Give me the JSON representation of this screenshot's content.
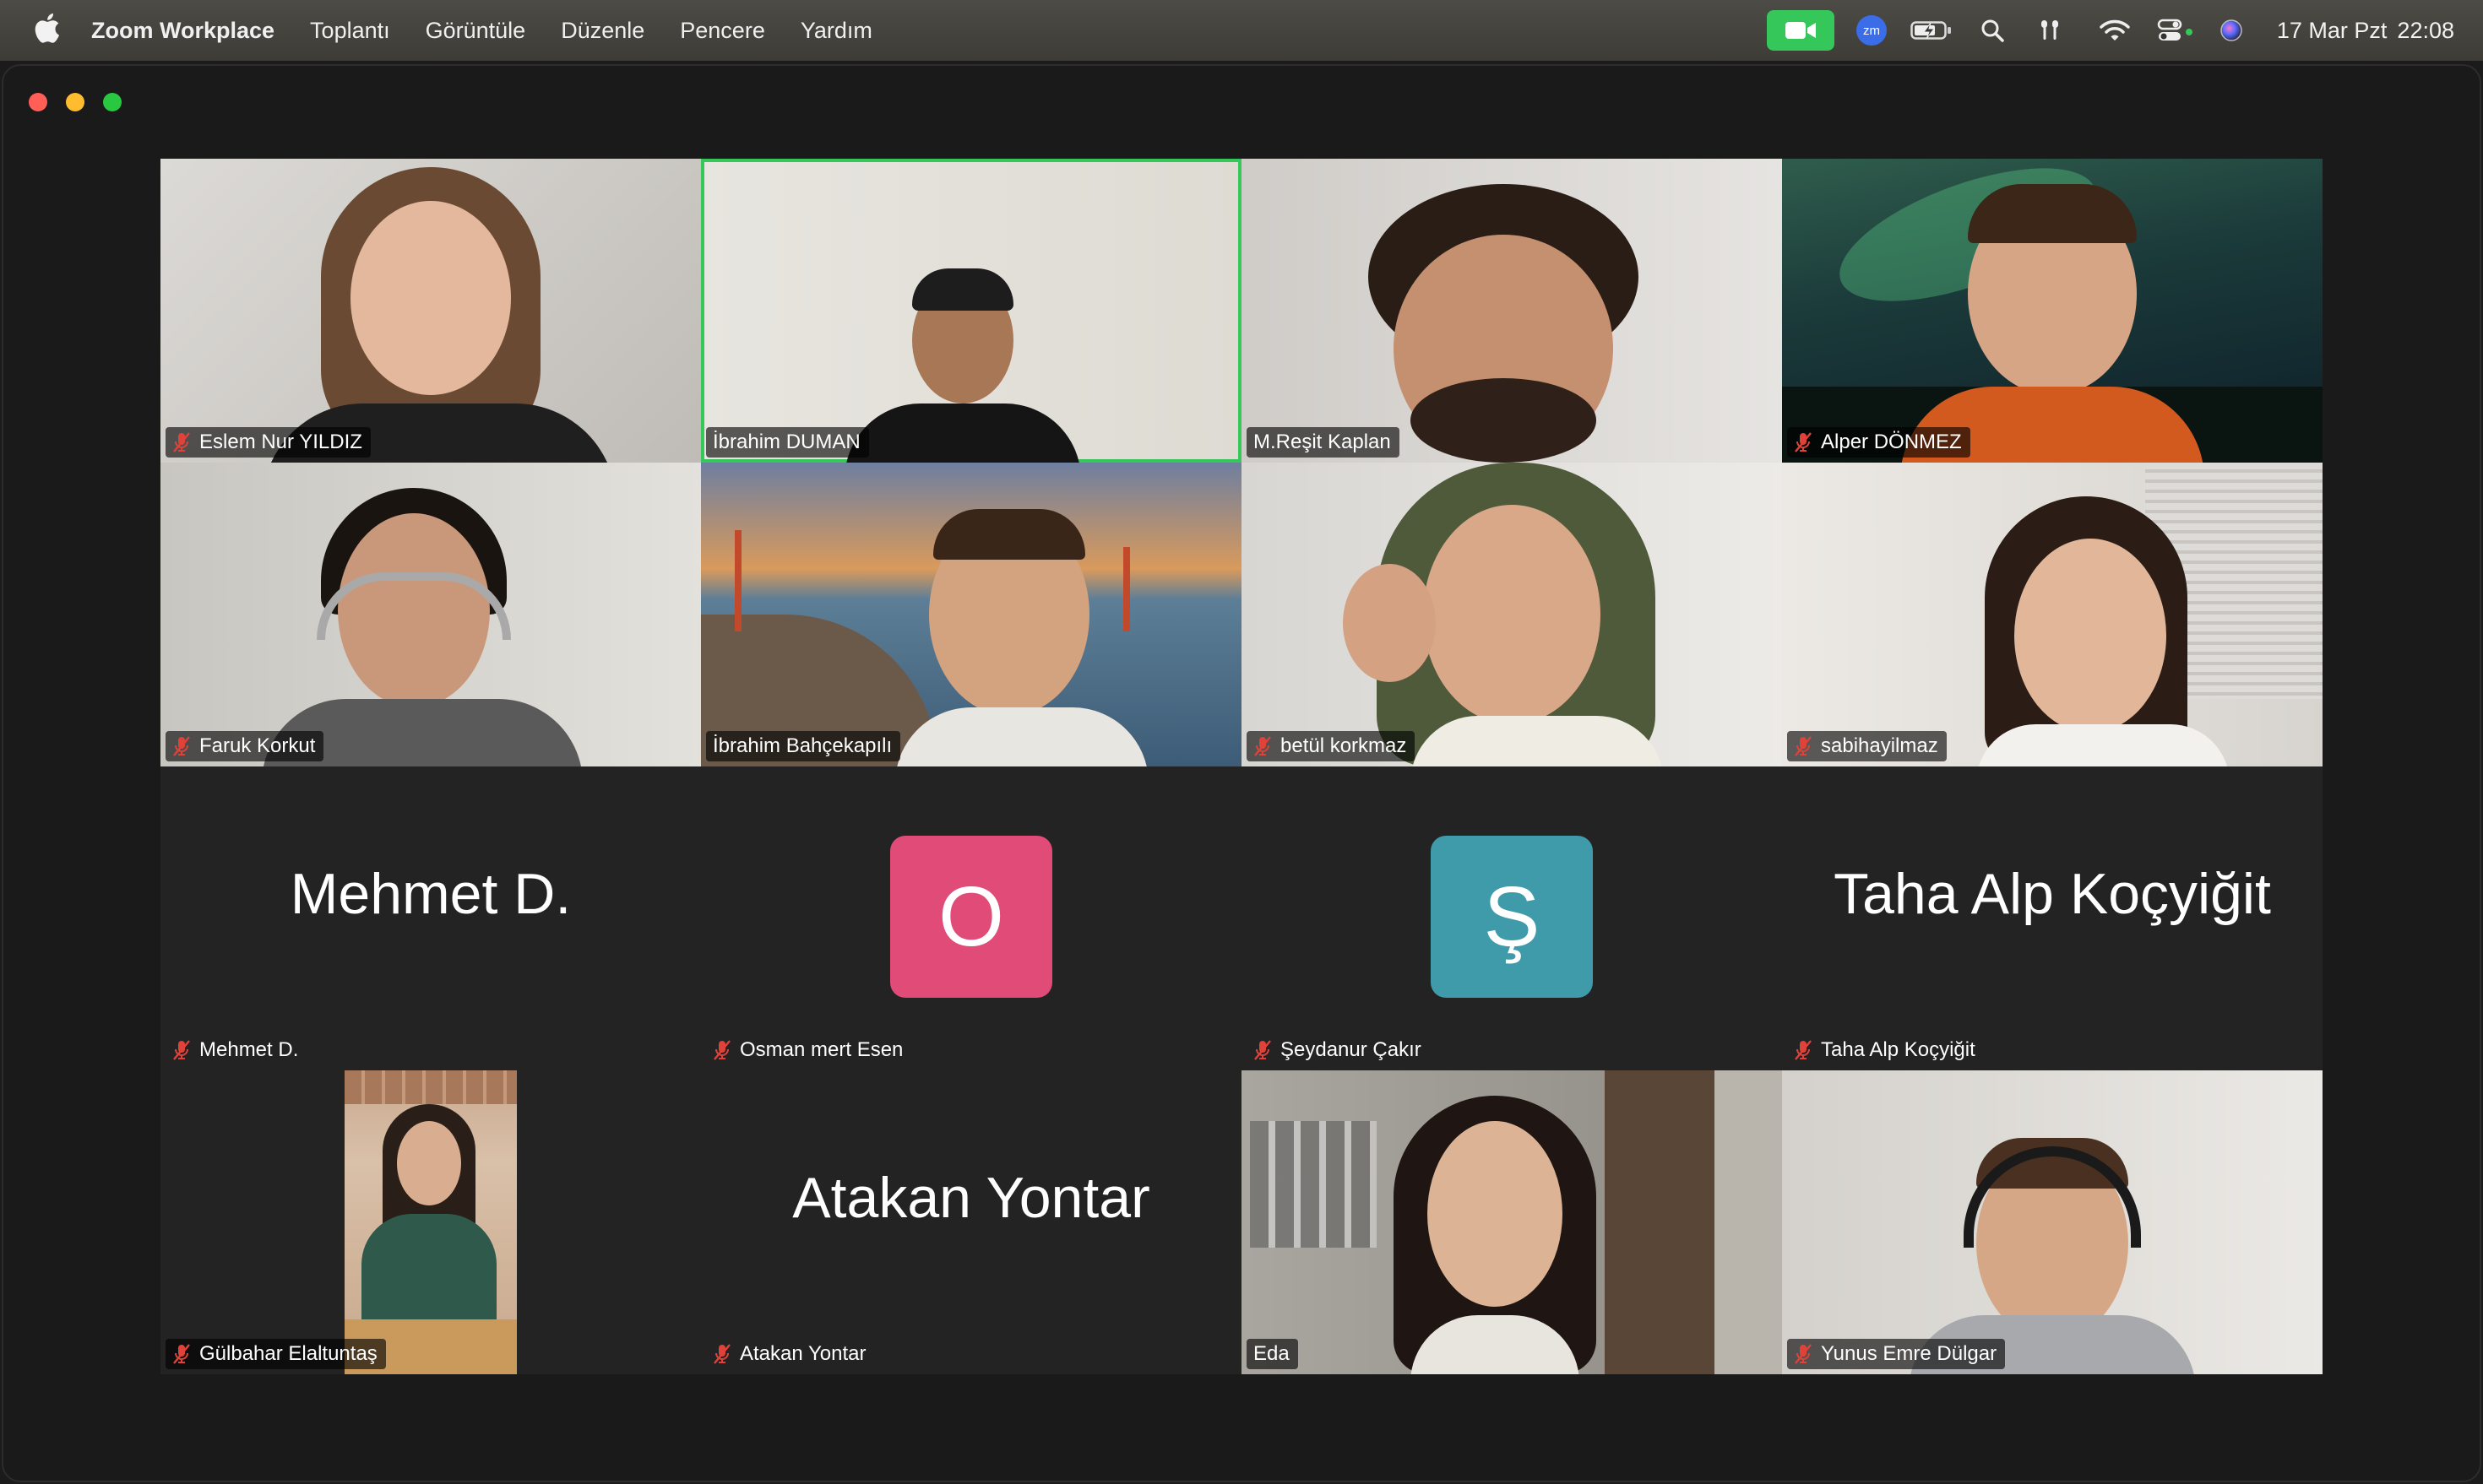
{
  "menubar": {
    "app_name": "Zoom Workplace",
    "items": [
      "Toplantı",
      "Görüntüle",
      "Düzenle",
      "Pencere",
      "Yardım"
    ],
    "status_icons": [
      "video-camera-icon",
      "zoom-icon",
      "battery-charging-icon",
      "search-icon",
      "airpods-icon",
      "wifi-icon",
      "control-center-icon",
      "siri-icon"
    ],
    "zoom_badge": "zm",
    "date": "17 Mar Pzt",
    "time": "22:08"
  },
  "colors": {
    "active_speaker_border": "#35c759",
    "mute_icon": "#e0423a",
    "avatar_osman": "#e04b78",
    "avatar_seydanur": "#3f9aa9",
    "tile_background": "#232323"
  },
  "participants": [
    {
      "name": "Eslem Nur YILDIZ",
      "muted": true,
      "video": true
    },
    {
      "name": "İbrahim DUMAN",
      "muted": false,
      "video": true,
      "active_speaker": true
    },
    {
      "name": "M.Reşit Kaplan",
      "muted": false,
      "video": true
    },
    {
      "name": "Alper DÖNMEZ",
      "muted": true,
      "video": true
    },
    {
      "name": "Faruk Korkut",
      "muted": true,
      "video": true
    },
    {
      "name": "İbrahim Bahçekapılı",
      "muted": false,
      "video": true
    },
    {
      "name": "betül korkmaz",
      "muted": true,
      "video": true
    },
    {
      "name": "sabihayilmaz",
      "muted": true,
      "video": true
    },
    {
      "name": "Mehmet D.",
      "muted": true,
      "video": false,
      "display_text": "Mehmet D."
    },
    {
      "name": "Osman mert Esen",
      "muted": true,
      "video": false,
      "avatar_letter": "O"
    },
    {
      "name": "Şeydanur Çakır",
      "muted": true,
      "video": false,
      "avatar_letter": "Ş"
    },
    {
      "name": "Taha Alp Koçyiğit",
      "muted": true,
      "video": false,
      "display_text": "Taha Alp Koçyiğit"
    },
    {
      "name": "Gülbahar Elaltuntaş",
      "muted": true,
      "video": true
    },
    {
      "name": "Atakan Yontar",
      "muted": true,
      "video": false,
      "display_text": "Atakan Yontar"
    },
    {
      "name": "Eda",
      "muted": false,
      "video": true
    },
    {
      "name": "Yunus Emre Dülgar",
      "muted": true,
      "video": true
    }
  ]
}
